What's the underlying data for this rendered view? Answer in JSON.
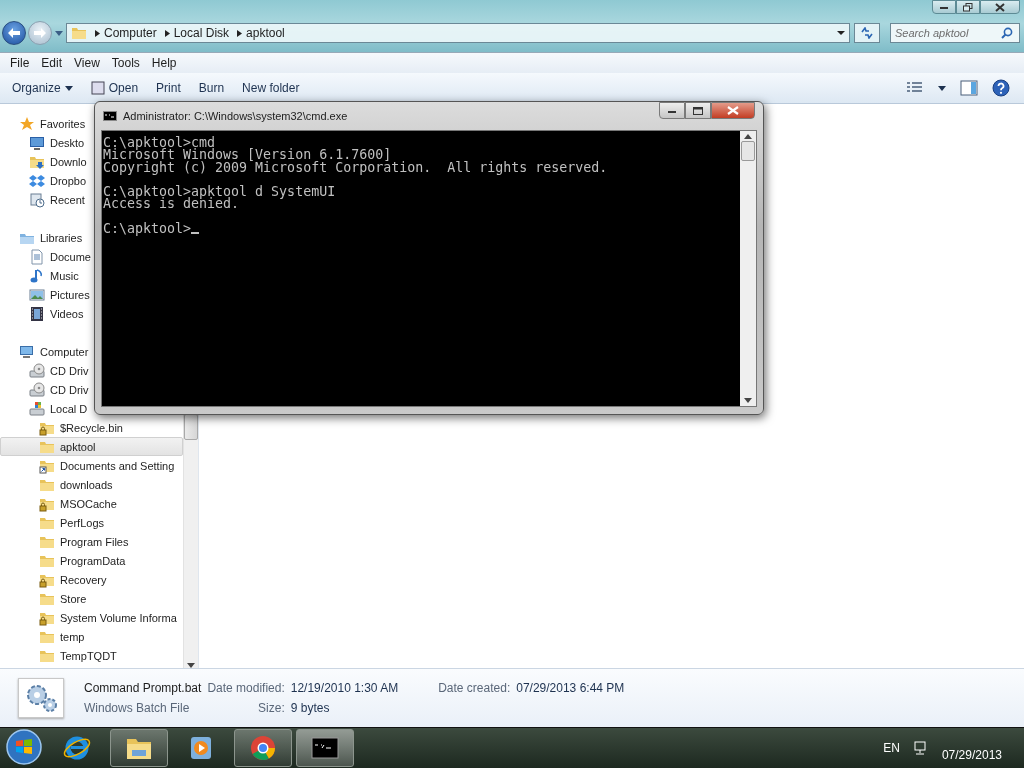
{
  "explorer": {
    "breadcrumb": [
      "Computer",
      "Local Disk",
      "apktool"
    ],
    "search": {
      "placeholder": "Search apktool"
    },
    "menu": [
      "File",
      "Edit",
      "View",
      "Tools",
      "Help"
    ],
    "commands": [
      {
        "label": "Organize",
        "kind": "dropdown"
      },
      {
        "label": "Open",
        "kind": "open"
      },
      {
        "label": "Print",
        "kind": "plain"
      },
      {
        "label": "Burn",
        "kind": "plain"
      },
      {
        "label": "New folder",
        "kind": "plain"
      }
    ],
    "navigation": [
      {
        "label": "Favorites",
        "kind": "favorites",
        "selected": false,
        "children": [
          {
            "label": "Deskto",
            "kind": "desktop",
            "selected": false
          },
          {
            "label": "Downlo",
            "kind": "downloads",
            "selected": false
          },
          {
            "label": "Dropbo",
            "kind": "dropbox",
            "selected": false
          },
          {
            "label": "Recent",
            "kind": "recent",
            "selected": false
          }
        ]
      },
      {
        "label": "Libraries",
        "kind": "libraries",
        "selected": false,
        "children": [
          {
            "label": "Docume",
            "kind": "documents",
            "selected": false
          },
          {
            "label": "Music",
            "kind": "music",
            "selected": false
          },
          {
            "label": "Pictures",
            "kind": "pictures",
            "selected": false
          },
          {
            "label": "Videos",
            "kind": "videos",
            "selected": false
          }
        ]
      },
      {
        "label": "Computer",
        "kind": "computer",
        "selected": false,
        "children": [
          {
            "label": "CD Driv",
            "kind": "cd-drive",
            "selected": false
          },
          {
            "label": "CD Driv",
            "kind": "cd-drive",
            "selected": false
          },
          {
            "label": "Local D",
            "kind": "local-disk",
            "selected": false,
            "children": [
              {
                "label": "$Recycle.bin",
                "kind": "locked-folder",
                "selected": false
              },
              {
                "label": "apktool",
                "kind": "folder",
                "selected": true
              },
              {
                "label": "Documents and Setting",
                "kind": "shortcut-folder",
                "selected": false
              },
              {
                "label": "downloads",
                "kind": "folder",
                "selected": false
              },
              {
                "label": "MSOCache",
                "kind": "locked-folder",
                "selected": false
              },
              {
                "label": "PerfLogs",
                "kind": "folder",
                "selected": false
              },
              {
                "label": "Program Files",
                "kind": "folder",
                "selected": false
              },
              {
                "label": "ProgramData",
                "kind": "folder",
                "selected": false
              },
              {
                "label": "Recovery",
                "kind": "locked-folder",
                "selected": false
              },
              {
                "label": "Store",
                "kind": "folder",
                "selected": false
              },
              {
                "label": "System Volume Informa",
                "kind": "locked-folder",
                "selected": false
              },
              {
                "label": "temp",
                "kind": "folder",
                "selected": false
              },
              {
                "label": "TempTQDT",
                "kind": "folder",
                "selected": false
              }
            ]
          }
        ]
      }
    ],
    "details": {
      "name": "Command Prompt.bat",
      "type": "Windows Batch File",
      "fields": [
        {
          "label": "Date modified:",
          "value": "12/19/2010 1:30 AM"
        },
        {
          "label": "Size:",
          "value": "9 bytes"
        },
        {
          "label": "Date created:",
          "value": "07/29/2013 6:44 PM"
        }
      ]
    }
  },
  "console": {
    "title": "Administrator: C:\\Windows\\system32\\cmd.exe",
    "blocks": [
      [
        "C:\\apktool>cmd",
        "Microsoft Windows [Version 6.1.7600]",
        "Copyright (c) 2009 Microsoft Corporation.  All rights reserved."
      ],
      [
        "C:\\apktool>apktool d SystemUI",
        "Access is denied."
      ],
      [
        "C:\\apktool>"
      ]
    ]
  },
  "taskbar": {
    "items": [
      {
        "kind": "ie",
        "running": false,
        "selected": false
      },
      {
        "kind": "explorer",
        "running": true,
        "selected": false
      },
      {
        "kind": "media",
        "running": false,
        "selected": false
      },
      {
        "kind": "chrome",
        "running": true,
        "selected": false
      },
      {
        "kind": "cmd",
        "running": true,
        "selected": true
      }
    ],
    "language": "EN",
    "date": "07/29/2013"
  }
}
